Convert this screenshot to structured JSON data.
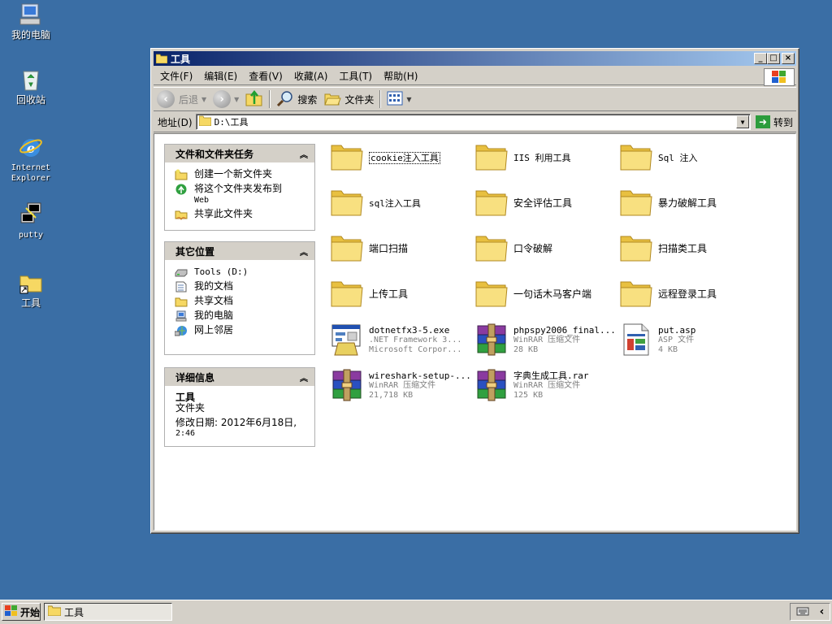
{
  "desktop": {
    "icons": [
      {
        "label": "我的电脑"
      },
      {
        "label": "回收站"
      },
      {
        "label": "Internet Explorer"
      },
      {
        "label": "putty"
      },
      {
        "label": "工具"
      }
    ]
  },
  "window": {
    "title": "工具",
    "buttons": {
      "minimize": "_",
      "maximize": "□",
      "close": "×"
    }
  },
  "menubar": {
    "items": [
      "文件(F)",
      "编辑(E)",
      "查看(V)",
      "收藏(A)",
      "工具(T)",
      "帮助(H)"
    ]
  },
  "toolbar": {
    "back": "后退",
    "search": "搜索",
    "folders": "文件夹"
  },
  "address": {
    "label": "地址(D)",
    "value": "D:\\工具",
    "go": "转到"
  },
  "tasks_panel": {
    "title": "文件和文件夹任务",
    "items": [
      "创建一个新文件夹",
      "将这个文件夹发布到",
      "Web",
      "共享此文件夹"
    ]
  },
  "places_panel": {
    "title": "其它位置",
    "items": [
      "Tools (D:)",
      "我的文档",
      "共享文档",
      "我的电脑",
      "网上邻居"
    ]
  },
  "details_panel": {
    "title": "详细信息",
    "name": "工具",
    "type": "文件夹",
    "modified": "修改日期: 2012年6月18日,",
    "modified_time": "2:46"
  },
  "files": [
    {
      "name": "cookie注入工具",
      "kind": "folder"
    },
    {
      "name": "IIS 利用工具",
      "kind": "folder"
    },
    {
      "name": "Sql 注入",
      "kind": "folder"
    },
    {
      "name": "sql注入工具",
      "kind": "folder"
    },
    {
      "name": "安全评估工具",
      "kind": "folder"
    },
    {
      "name": "暴力破解工具",
      "kind": "folder"
    },
    {
      "name": "端口扫描",
      "kind": "folder"
    },
    {
      "name": "口令破解",
      "kind": "folder"
    },
    {
      "name": "扫描类工具",
      "kind": "folder"
    },
    {
      "name": "上传工具",
      "kind": "folder"
    },
    {
      "name": "一句话木马客户端",
      "kind": "folder"
    },
    {
      "name": "远程登录工具",
      "kind": "folder"
    },
    {
      "name": "dotnetfx3-5.exe",
      "sub1": ".NET Framework 3...",
      "sub2": "Microsoft Corpor...",
      "kind": "exe"
    },
    {
      "name": "phpspy2006_final...",
      "sub1": "WinRAR 压缩文件",
      "sub2": "28 KB",
      "kind": "rar"
    },
    {
      "name": "put.asp",
      "sub1": "ASP 文件",
      "sub2": "4 KB",
      "kind": "asp"
    },
    {
      "name": "wireshark-setup-...",
      "sub1": "WinRAR 压缩文件",
      "sub2": "21,718 KB",
      "kind": "rar"
    },
    {
      "name": "字典生成工具.rar",
      "sub1": "WinRAR 压缩文件",
      "sub2": "125 KB",
      "kind": "rar"
    }
  ],
  "taskbar": {
    "start": "开始",
    "task_button": "工具"
  },
  "colors": {
    "desktop": "#3a6ea5",
    "titlebar_start": "#0a246a",
    "titlebar_end": "#a6caf0",
    "folder": "#f6d863"
  }
}
